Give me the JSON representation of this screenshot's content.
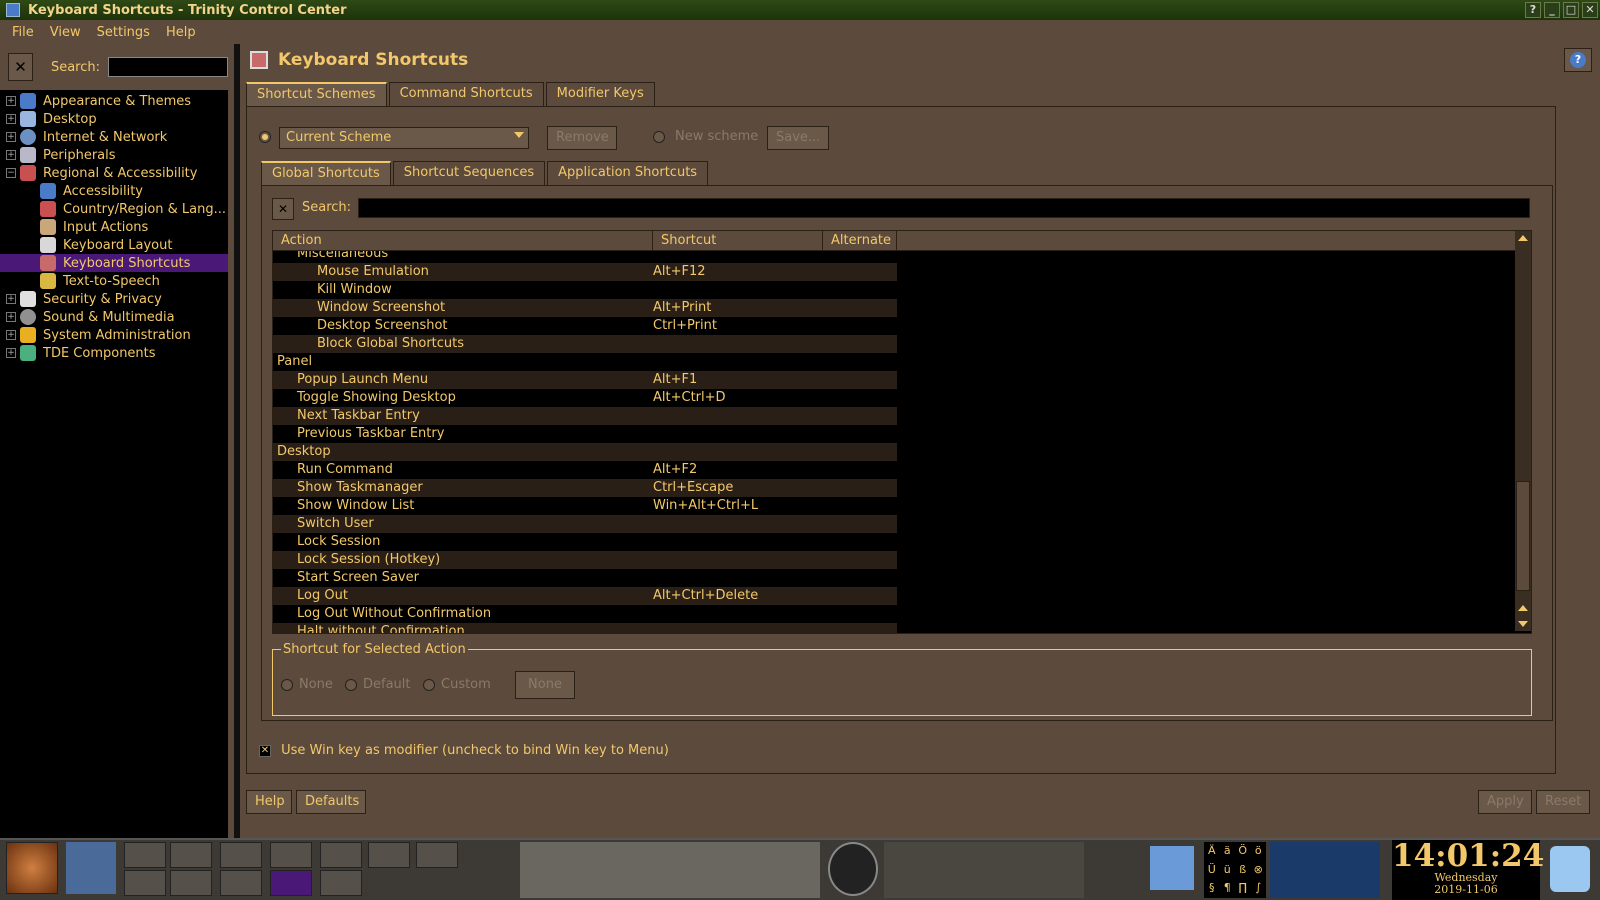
{
  "window": {
    "title": "Keyboard Shortcuts - Trinity Control Center"
  },
  "menubar": {
    "items": [
      "File",
      "View",
      "Settings",
      "Help"
    ]
  },
  "sidebar": {
    "search_label": "Search:",
    "items": [
      {
        "label": "Appearance & Themes",
        "color": "#4a7bc8"
      },
      {
        "label": "Desktop",
        "color": "#9ab6e0"
      },
      {
        "label": "Internet & Network",
        "color": "#6c8fc4"
      },
      {
        "label": "Peripherals",
        "color": "#b8b8c8"
      },
      {
        "label": "Regional & Accessibility",
        "color": "#c85050"
      },
      {
        "label": "Accessibility",
        "color": "#4a7bc8"
      },
      {
        "label": "Country/Region & Lang...",
        "color": "#c85050"
      },
      {
        "label": "Input Actions",
        "color": "#c8a878"
      },
      {
        "label": "Keyboard Layout",
        "color": "#d8d8d8"
      },
      {
        "label": "Keyboard Shortcuts",
        "color": "#c86a6a"
      },
      {
        "label": "Text-to-Speech",
        "color": "#d8b840"
      },
      {
        "label": "Security & Privacy",
        "color": "#e0e0e0"
      },
      {
        "label": "Sound & Multimedia",
        "color": "#909090"
      },
      {
        "label": "System Administration",
        "color": "#e8b020"
      },
      {
        "label": "TDE Components",
        "color": "#4ab080"
      }
    ]
  },
  "main": {
    "header": "Keyboard Shortcuts",
    "tabs": [
      "Shortcut Schemes",
      "Command Shortcuts",
      "Modifier Keys"
    ],
    "scheme": {
      "selected": "Current Scheme",
      "remove": "Remove",
      "new_scheme": "New scheme",
      "save": "Save..."
    },
    "subtabs": [
      "Global Shortcuts",
      "Shortcut Sequences",
      "Application Shortcuts"
    ],
    "search_label": "Search:",
    "columns": [
      "Action",
      "Shortcut",
      "Alternate"
    ],
    "rows": [
      {
        "action": "Miscellaneous",
        "shortcut": "",
        "level": "l1"
      },
      {
        "action": "Mouse Emulation",
        "shortcut": "Alt+F12",
        "level": "l2"
      },
      {
        "action": "Kill Window",
        "shortcut": "",
        "level": "l2"
      },
      {
        "action": "Window Screenshot",
        "shortcut": "Alt+Print",
        "level": "l2"
      },
      {
        "action": "Desktop Screenshot",
        "shortcut": "Ctrl+Print",
        "level": "l2"
      },
      {
        "action": "Block Global Shortcuts",
        "shortcut": "",
        "level": "l2"
      },
      {
        "action": "Panel",
        "shortcut": "",
        "level": "group"
      },
      {
        "action": "Popup Launch Menu",
        "shortcut": "Alt+F1",
        "level": "l1"
      },
      {
        "action": "Toggle Showing Desktop",
        "shortcut": "Alt+Ctrl+D",
        "level": "l1"
      },
      {
        "action": "Next Taskbar Entry",
        "shortcut": "",
        "level": "l1"
      },
      {
        "action": "Previous Taskbar Entry",
        "shortcut": "",
        "level": "l1"
      },
      {
        "action": "Desktop",
        "shortcut": "",
        "level": "group"
      },
      {
        "action": "Run Command",
        "shortcut": "Alt+F2",
        "level": "l1"
      },
      {
        "action": "Show Taskmanager",
        "shortcut": "Ctrl+Escape",
        "level": "l1"
      },
      {
        "action": "Show Window List",
        "shortcut": "Win+Alt+Ctrl+L",
        "level": "l1"
      },
      {
        "action": "Switch User",
        "shortcut": "",
        "level": "l1"
      },
      {
        "action": "Lock Session",
        "shortcut": "",
        "level": "l1"
      },
      {
        "action": "Lock Session (Hotkey)",
        "shortcut": "",
        "level": "l1"
      },
      {
        "action": "Start Screen Saver",
        "shortcut": "",
        "level": "l1"
      },
      {
        "action": "Log Out",
        "shortcut": "Alt+Ctrl+Delete",
        "level": "l1"
      },
      {
        "action": "Log Out Without Confirmation",
        "shortcut": "",
        "level": "l1"
      },
      {
        "action": "Halt without Confirmation",
        "shortcut": "",
        "level": "l1"
      }
    ],
    "group_box": {
      "title": "Shortcut for Selected Action",
      "none": "None",
      "default": "Default",
      "custom": "Custom",
      "button": "None"
    },
    "win_key_checkbox": "Use Win key as modifier (uncheck to bind Win key to Menu)",
    "buttons": {
      "help": "Help",
      "defaults": "Defaults",
      "apply": "Apply",
      "reset": "Reset"
    }
  },
  "clock": {
    "time": "14:01:24",
    "day": "Wednesday",
    "date": "2019-11-06"
  },
  "tray": {
    "chars": [
      "Ä",
      "ä",
      "Ö",
      "ö",
      "Ü",
      "ü",
      "ß",
      "⊗",
      "§",
      "¶",
      "∏",
      "∫"
    ]
  }
}
